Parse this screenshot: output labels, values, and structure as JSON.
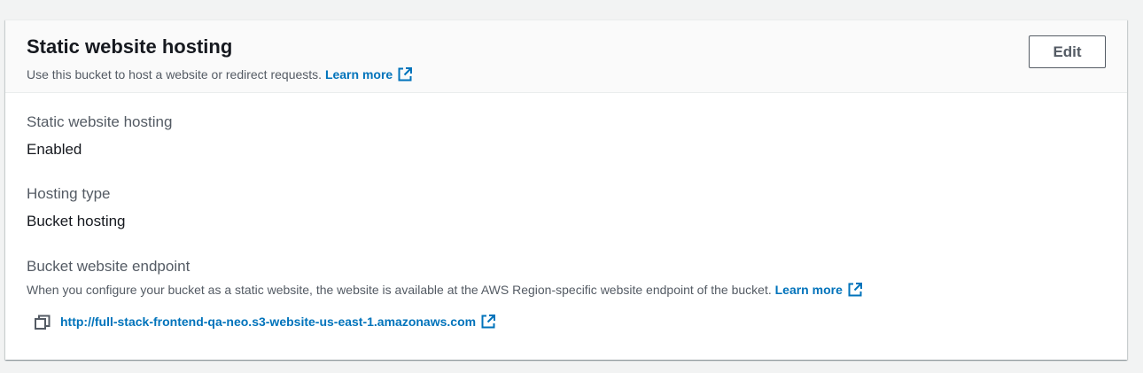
{
  "panel": {
    "title": "Static website hosting",
    "description": "Use this bucket to host a website or redirect requests.",
    "learn_more": "Learn more",
    "edit_label": "Edit"
  },
  "fields": {
    "hosting_status": {
      "label": "Static website hosting",
      "value": "Enabled"
    },
    "hosting_type": {
      "label": "Hosting type",
      "value": "Bucket hosting"
    },
    "endpoint": {
      "label": "Bucket website endpoint",
      "description": "When you configure your bucket as a static website, the website is available at the AWS Region-specific website endpoint of the bucket.",
      "learn_more": "Learn more",
      "url": "http://full-stack-frontend-qa-neo.s3-website-us-east-1.amazonaws.com"
    }
  },
  "icons": {
    "external": "external-link-icon",
    "copy": "copy-icon"
  },
  "colors": {
    "link": "#0073bb",
    "text": "#16191f",
    "secondary_text": "#545b64",
    "background": "#f2f3f3"
  }
}
